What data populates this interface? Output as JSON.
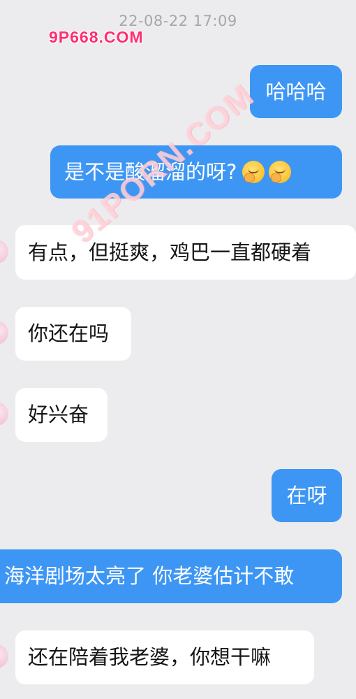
{
  "header": {
    "timestamp": "22-08-22 17:09"
  },
  "watermarks": {
    "top": "9P668.COM",
    "diagonal": "91PORN.COM"
  },
  "messages": [
    {
      "side": "out",
      "text": "哈哈哈"
    },
    {
      "side": "out",
      "text": "是不是酸溜溜的呀?",
      "emoji": [
        "face-with-hand-over-mouth-icon",
        "face-with-hand-over-mouth-icon"
      ]
    },
    {
      "side": "in",
      "text": "有点，但挺爽，鸡巴一直都硬着"
    },
    {
      "side": "in",
      "text": "你还在吗"
    },
    {
      "side": "in",
      "text": "好兴奋"
    },
    {
      "side": "out",
      "text": "在呀"
    },
    {
      "side": "out",
      "text": "海洋剧场太亮了 你老婆估计不敢"
    },
    {
      "side": "in",
      "text": "还在陪着我老婆，你想干嘛"
    }
  ],
  "colors": {
    "background": "#ececef",
    "outgoing_bubble": "#3d96f4",
    "incoming_bubble": "#ffffff"
  }
}
